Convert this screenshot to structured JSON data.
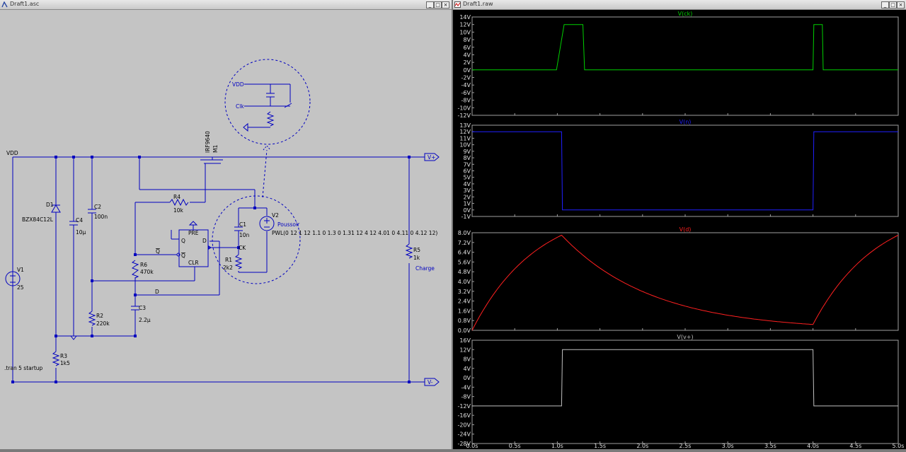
{
  "schematic_window": {
    "title": "Draft1.asc"
  },
  "waveform_window": {
    "title": "Draft1.raw"
  },
  "schematic": {
    "net_vdd": "VDD",
    "port_vplus": "V+",
    "port_vminus": "V-",
    "d1": {
      "ref": "D1",
      "value": "BZX84C12L"
    },
    "c4": {
      "ref": "C4",
      "value": "10µ"
    },
    "c2": {
      "ref": "C2",
      "value": "100n"
    },
    "r4": {
      "ref": "R4",
      "value": "10k"
    },
    "m1": {
      "ref": "M1",
      "value": "IRF9640"
    },
    "v1": {
      "ref": "V1",
      "value": "25"
    },
    "r6": {
      "ref": "R6",
      "value": "470k"
    },
    "r2": {
      "ref": "R2",
      "value": "220k"
    },
    "c3": {
      "ref": "C3",
      "value": "2.2µ"
    },
    "r3": {
      "ref": "R3",
      "value": "1k5"
    },
    "c1": {
      "ref": "C1",
      "value": "10n"
    },
    "r1": {
      "ref": "R1",
      "value": "2k2"
    },
    "v2": {
      "ref": "V2",
      "name": "Poussoir",
      "value": "PWL(0 12 1 12 1.1 0 1.3 0 1.31 12 4 12 4.01 0 4.11 0 4.12 12)"
    },
    "r5": {
      "ref": "R5",
      "value": "1k",
      "name": "Charge"
    },
    "net_d": "D",
    "tran": ".tran 5 startup",
    "ff": {
      "pre": "PRE",
      "clr": "CLR",
      "q": "Q",
      "qbar": "Q",
      "d": "D",
      "ck": "CK"
    },
    "inset": {
      "vdd": "VDD",
      "clk": "Clk"
    }
  },
  "panes": [
    {
      "trace": "V(ck)",
      "color": "#00d000",
      "ticks": [
        "14V",
        "12V",
        "10V",
        "8V",
        "6V",
        "4V",
        "2V",
        "0V",
        "-2V",
        "-4V",
        "-6V",
        "-8V",
        "-10V",
        "-12V"
      ]
    },
    {
      "trace": "V(n)",
      "color": "#2020ff",
      "ticks": [
        "13V",
        "12V",
        "11V",
        "10V",
        "9V",
        "8V",
        "7V",
        "6V",
        "5V",
        "4V",
        "3V",
        "2V",
        "1V",
        "0V",
        "-1V"
      ]
    },
    {
      "trace": "V(d)",
      "color": "#ff2020",
      "ticks": [
        "8.0V",
        "7.2V",
        "6.4V",
        "5.6V",
        "4.8V",
        "4.0V",
        "3.2V",
        "2.4V",
        "1.6V",
        "0.8V",
        "0.0V"
      ]
    },
    {
      "trace": "V(v+)",
      "color": "#c0c0c0",
      "ticks": [
        "16V",
        "12V",
        "8V",
        "4V",
        "0V",
        "-4V",
        "-8V",
        "-12V",
        "-16V",
        "-20V",
        "-24V",
        "-28V"
      ]
    }
  ],
  "x_ticks": [
    "0.0s",
    "0.5s",
    "1.0s",
    "1.5s",
    "2.0s",
    "2.5s",
    "3.0s",
    "3.5s",
    "4.0s",
    "4.5s",
    "5.0s"
  ],
  "chart_data": [
    {
      "type": "line",
      "title": "V(ck)",
      "x": [
        0,
        0.99,
        1.08,
        1.3,
        1.32,
        4.0,
        4.01,
        4.11,
        4.12,
        5.0
      ],
      "y": [
        0,
        0,
        12,
        12,
        0,
        0,
        12,
        12,
        0,
        0
      ],
      "ylim": [
        -12,
        14
      ],
      "xlim": [
        0,
        5
      ]
    },
    {
      "type": "line",
      "title": "V(n)",
      "x": [
        0,
        1.05,
        1.06,
        4.0,
        4.01,
        5.0
      ],
      "y": [
        12,
        12,
        0,
        0,
        12,
        12
      ],
      "ylim": [
        -1,
        13
      ],
      "xlim": [
        0,
        5
      ]
    },
    {
      "type": "line",
      "title": "V(d)",
      "x": [
        0,
        0.25,
        0.5,
        0.75,
        1.05,
        1.5,
        2.0,
        2.5,
        3.0,
        3.5,
        4.0,
        4.25,
        4.5,
        4.75,
        5.0
      ],
      "y": [
        0,
        2.5,
        4.4,
        6.1,
        7.8,
        5.6,
        3.7,
        2.4,
        1.5,
        0.9,
        0.55,
        2.4,
        4.3,
        6.2,
        7.8
      ],
      "ylim": [
        0,
        8
      ],
      "xlim": [
        0,
        5
      ]
    },
    {
      "type": "line",
      "title": "V(v+)",
      "x": [
        0,
        1.05,
        1.06,
        4.0,
        4.01,
        5.0
      ],
      "y": [
        -12,
        -12,
        12,
        12,
        -12,
        -12
      ],
      "ylim": [
        -28,
        16
      ],
      "xlim": [
        0,
        5
      ]
    }
  ]
}
